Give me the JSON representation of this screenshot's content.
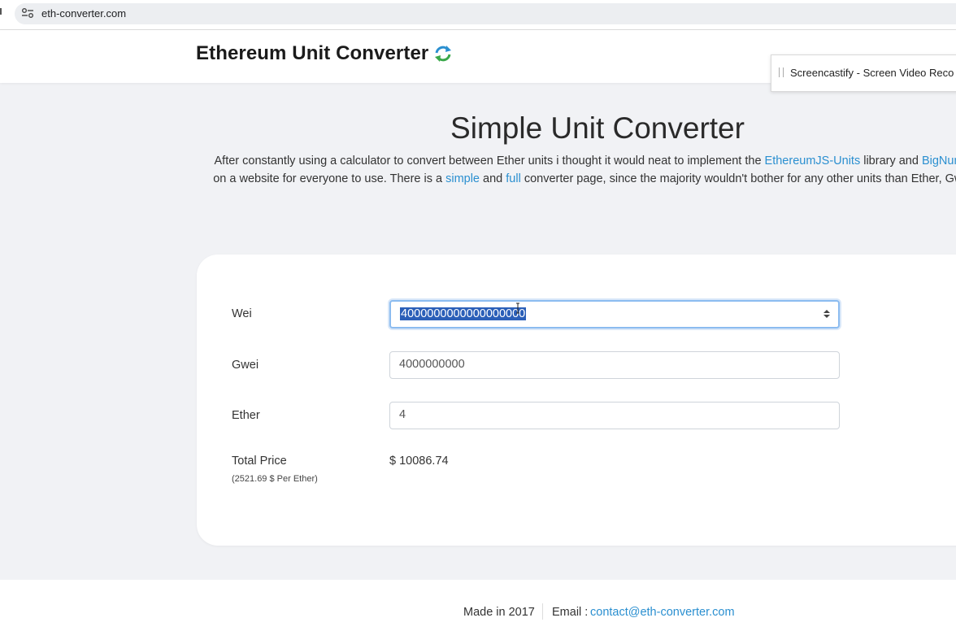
{
  "browser": {
    "url": "eth-converter.com"
  },
  "header": {
    "brand": "Ethereum Unit Converter"
  },
  "extension_popup": {
    "label": "Screencastify - Screen Video Reco"
  },
  "hero": {
    "title": "Simple Unit Converter",
    "line1_pre": "After constantly using a calculator to convert between Ether units i thought it would neat to implement the ",
    "line1_link1": "EthereumJS-Units",
    "line1_mid": " library and ",
    "line1_link2": "BigNumber",
    "line2_pre": "on a website for everyone to use. There is a ",
    "line2_link1": "simple",
    "line2_mid": " and ",
    "line2_link2": "full",
    "line2_post": " converter page, since the majority wouldn't bother for any other units than Ether, Gwei a"
  },
  "converter": {
    "rows": [
      {
        "label": "Wei",
        "value": "4000000000000000000"
      },
      {
        "label": "Gwei",
        "value": "4000000000"
      },
      {
        "label": "Ether",
        "value": "4"
      }
    ],
    "total_label": "Total Price",
    "total_value": "$ 10086.74",
    "per_ether": "(2521.69 $ Per Ether)"
  },
  "footer": {
    "made_in": "Made in 2017",
    "email_label": "Email :",
    "email": "contact@eth-converter.com"
  },
  "colors": {
    "link": "#2a8fd0",
    "brand_icon_green": "#3aa84a",
    "brand_icon_blue": "#2a8fd0",
    "selection": "#2b5fb8"
  }
}
